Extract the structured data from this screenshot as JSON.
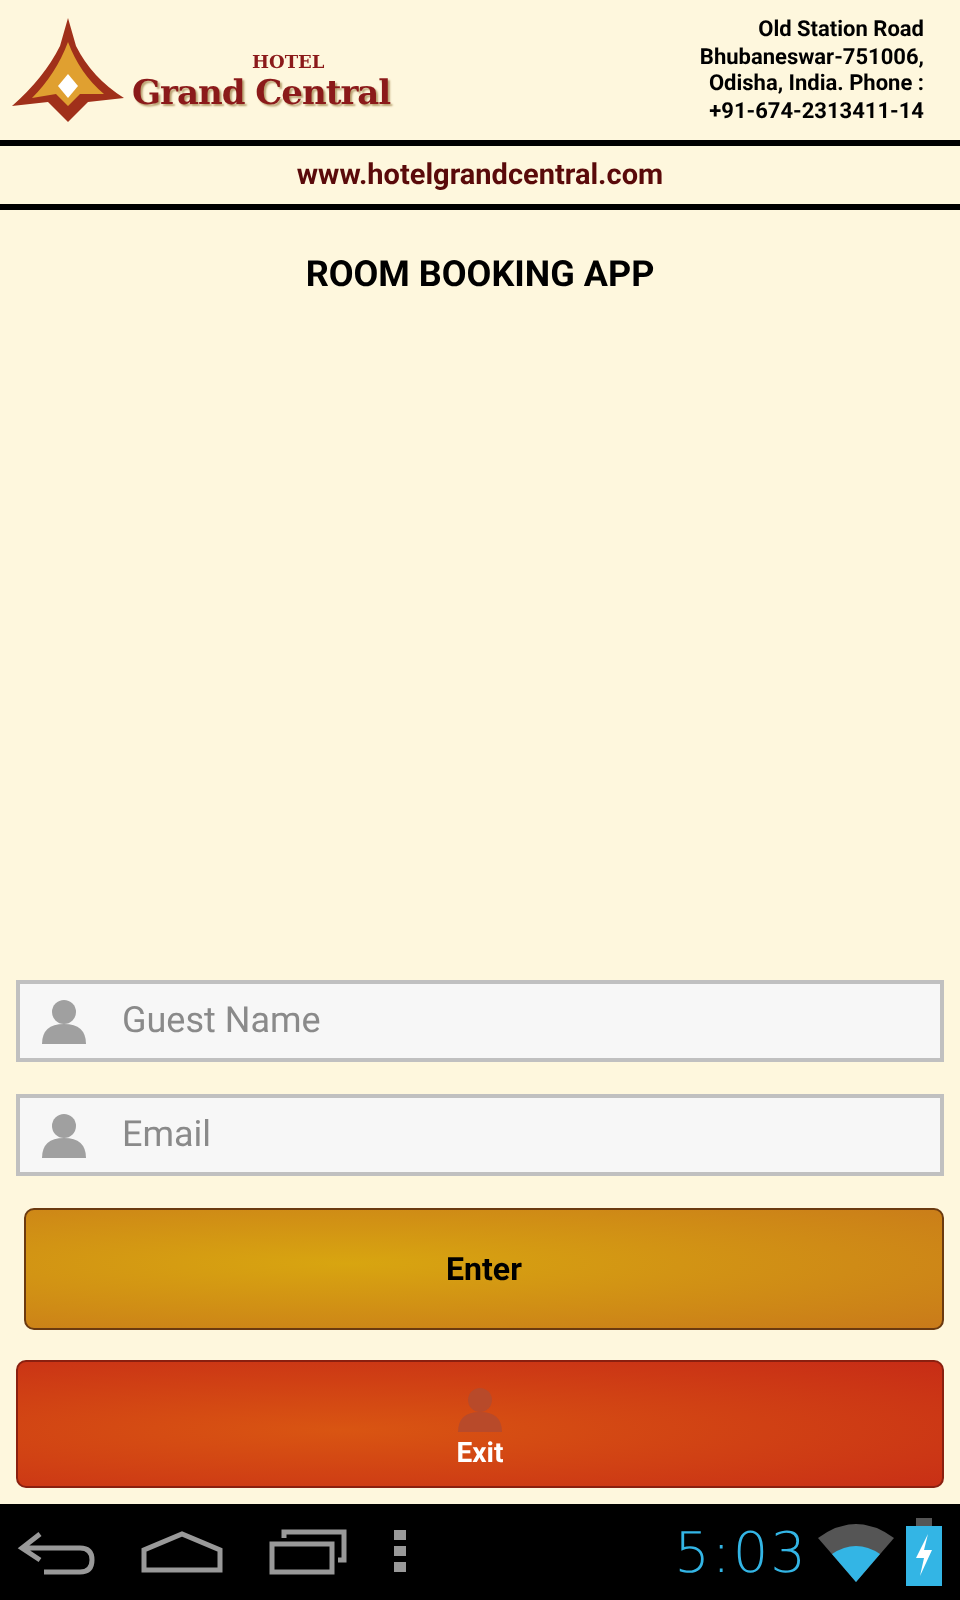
{
  "header": {
    "logo_small": "HOTEL",
    "logo_name": "Grand Central",
    "address_lines": [
      "Old Station Road",
      "Bhubaneswar-751006,",
      "Odisha, India. Phone :",
      "+91-674-2313411-14"
    ],
    "website": "www.hotelgrandcentral.com"
  },
  "title": "ROOM BOOKING APP",
  "fields": [
    {
      "placeholder": "Guest Name"
    },
    {
      "placeholder": "Email"
    }
  ],
  "buttons": [
    {
      "kind": "enter",
      "label": "Enter"
    },
    {
      "kind": "exit",
      "label": "Exit"
    }
  ],
  "status_bar": {
    "time": "5:03"
  }
}
